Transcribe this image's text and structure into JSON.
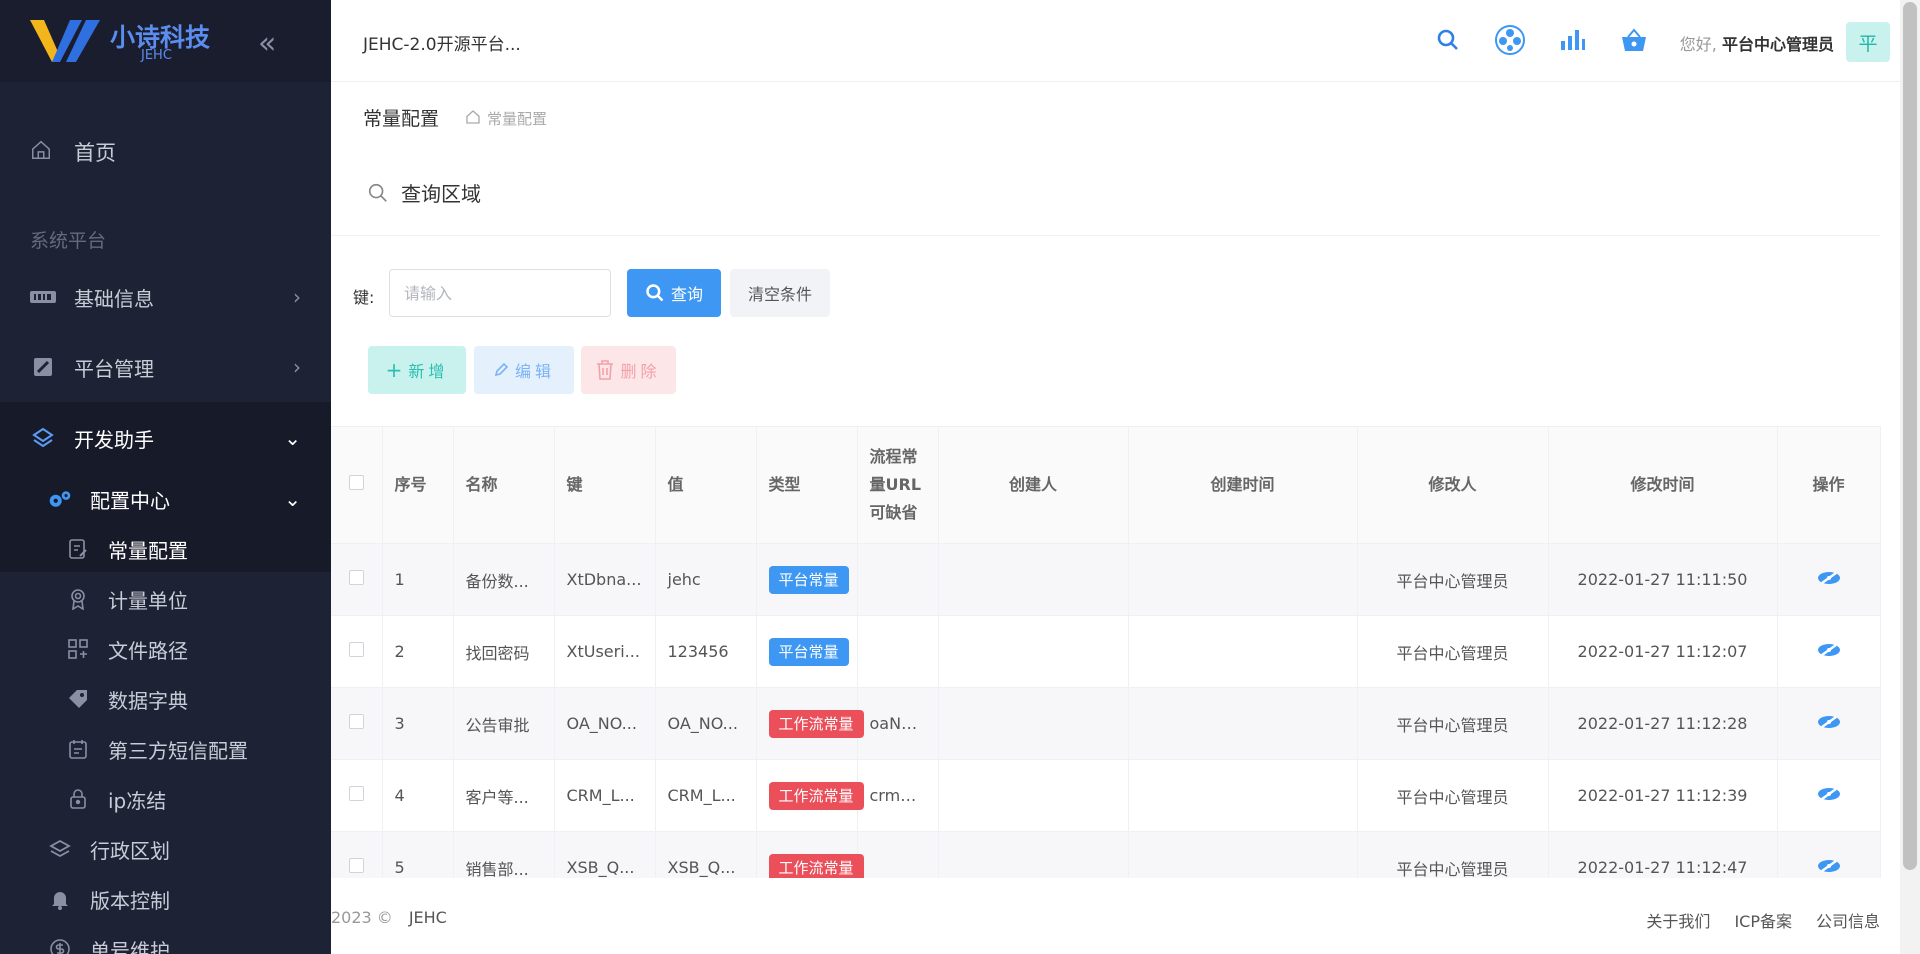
{
  "app": {
    "logo_title": "小诗科技",
    "logo_sub": "JEHC",
    "header_title": "JEHC-2.0开源平台...",
    "greeting": "您好,",
    "user_name": "平台中心管理员",
    "avatar_letter": "平"
  },
  "sidebar": {
    "home": "首页",
    "section": "系统平台",
    "items": [
      {
        "label": "基础信息",
        "icon": "barcode-icon"
      },
      {
        "label": "平台管理",
        "icon": "platform-icon"
      },
      {
        "label": "开发助手",
        "icon": "layers-icon"
      }
    ],
    "group": {
      "label": "配置中心",
      "icon": "gears-icon"
    },
    "sub_items": [
      {
        "label": "常量配置",
        "icon": "document-edit-icon"
      },
      {
        "label": "计量单位",
        "icon": "award-icon"
      },
      {
        "label": "文件路径",
        "icon": "grid-icon"
      },
      {
        "label": "数据字典",
        "icon": "tag-icon"
      },
      {
        "label": "第三方短信配置",
        "icon": "calendar-icon"
      },
      {
        "label": "ip冻结",
        "icon": "lock-icon"
      }
    ],
    "more_items": [
      {
        "label": "行政区划",
        "icon": "layers-icon"
      },
      {
        "label": "版本控制",
        "icon": "bell-icon"
      },
      {
        "label": "单号维护",
        "icon": "dollar-icon"
      }
    ]
  },
  "breadcrumb": {
    "title": "常量配置",
    "path": "常量配置"
  },
  "query": {
    "heading": "查询区域",
    "key_label": "键:",
    "placeholder": "请输入",
    "search_label": "查询",
    "clear_label": "清空条件"
  },
  "toolbar": {
    "add_label": "新增",
    "edit_label": "编辑",
    "delete_label": "删除"
  },
  "table": {
    "headers": [
      "序号",
      "名称",
      "键",
      "值",
      "类型",
      "流程常量URL可缺省",
      "创建人",
      "创建时间",
      "修改人",
      "修改时间",
      "操作"
    ],
    "rows": [
      {
        "no": "1",
        "name": "备份数...",
        "key": "XtDbna...",
        "value": "jehc",
        "type": "平台常量",
        "type_color": "blue",
        "url": "",
        "creator": "",
        "created": "",
        "modifier": "平台中心管理员",
        "modified": "2022-01-27 11:11:50"
      },
      {
        "no": "2",
        "name": "找回密码",
        "key": "XtUseri...",
        "value": "123456",
        "type": "平台常量",
        "type_color": "blue",
        "url": "",
        "creator": "",
        "created": "",
        "modifier": "平台中心管理员",
        "modified": "2022-01-27 11:12:07"
      },
      {
        "no": "3",
        "name": "公告审批",
        "key": "OA_NO...",
        "value": "OA_NO...",
        "type": "工作流常量",
        "type_color": "red",
        "url": "oaNotic...",
        "creator": "",
        "created": "",
        "modifier": "平台中心管理员",
        "modified": "2022-01-27 11:12:28"
      },
      {
        "no": "4",
        "name": "客户等...",
        "key": "CRM_L...",
        "value": "CRM_L...",
        "type": "工作流常量",
        "type_color": "red",
        "url": "crmCus...",
        "creator": "",
        "created": "",
        "modifier": "平台中心管理员",
        "modified": "2022-01-27 11:12:39"
      },
      {
        "no": "5",
        "name": "销售部...",
        "key": "XSB_Q...",
        "value": "XSB_Q...",
        "type": "工作流常量",
        "type_color": "red",
        "url": "",
        "creator": "",
        "created": "",
        "modifier": "平台中心管理员",
        "modified": "2022-01-27 11:12:47"
      }
    ]
  },
  "footer": {
    "copyright": "2023 ©",
    "brand": "JEHC",
    "links": [
      "关于我们",
      "ICP备案",
      "公司信息"
    ]
  },
  "colors": {
    "sidebar_bg": "#1e2235",
    "primary": "#3e97f2",
    "danger": "#ea4f5a",
    "teal": "#2bbfae"
  }
}
